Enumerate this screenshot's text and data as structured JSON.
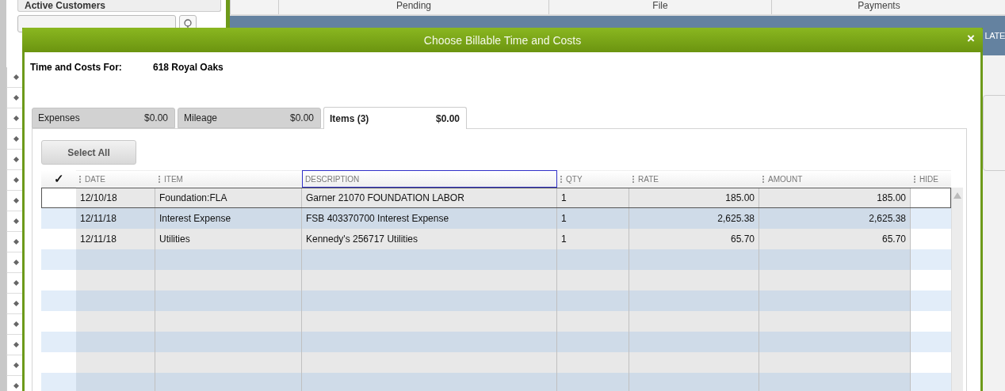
{
  "background": {
    "sidebar_title": "Active Customers",
    "columns": [
      "Pending",
      "File",
      "Payments"
    ],
    "banner_text": "LATE"
  },
  "dialog": {
    "title": "Choose Billable Time and Costs",
    "close": "×",
    "for_label": "Time and Costs For:",
    "for_value": "618 Royal Oaks",
    "tabs": [
      {
        "label": "Expenses",
        "amount": "$0.00",
        "selected": false
      },
      {
        "label": "Mileage",
        "amount": "$0.00",
        "selected": false
      },
      {
        "label": "Items (3)",
        "amount": "$0.00",
        "selected": true
      }
    ],
    "select_all": "Select All",
    "table": {
      "check_header": "✓",
      "columns": [
        {
          "label": "DATE",
          "focused": false
        },
        {
          "label": "ITEM",
          "focused": false
        },
        {
          "label": "DESCRIPTION",
          "focused": true
        },
        {
          "label": "QTY",
          "focused": false
        },
        {
          "label": "RATE",
          "focused": false
        },
        {
          "label": "AMOUNT",
          "focused": false
        },
        {
          "label": "HIDE",
          "focused": false
        }
      ],
      "rows": [
        {
          "selected": true,
          "cells": [
            "12/10/18",
            "Foundation:FLA",
            "Garner 21070 FOUNDATION LABOR",
            "1",
            "185.00",
            "185.00"
          ]
        },
        {
          "selected": false,
          "cells": [
            "12/11/18",
            "Interest Expense",
            "FSB 403370700 Interest Expense",
            "1",
            "2,625.38",
            "2,625.38"
          ]
        },
        {
          "selected": false,
          "cells": [
            "12/11/18",
            "Utilities",
            "Kennedy's 256717 Utilities",
            "1",
            "65.70",
            "65.70"
          ]
        }
      ]
    }
  }
}
